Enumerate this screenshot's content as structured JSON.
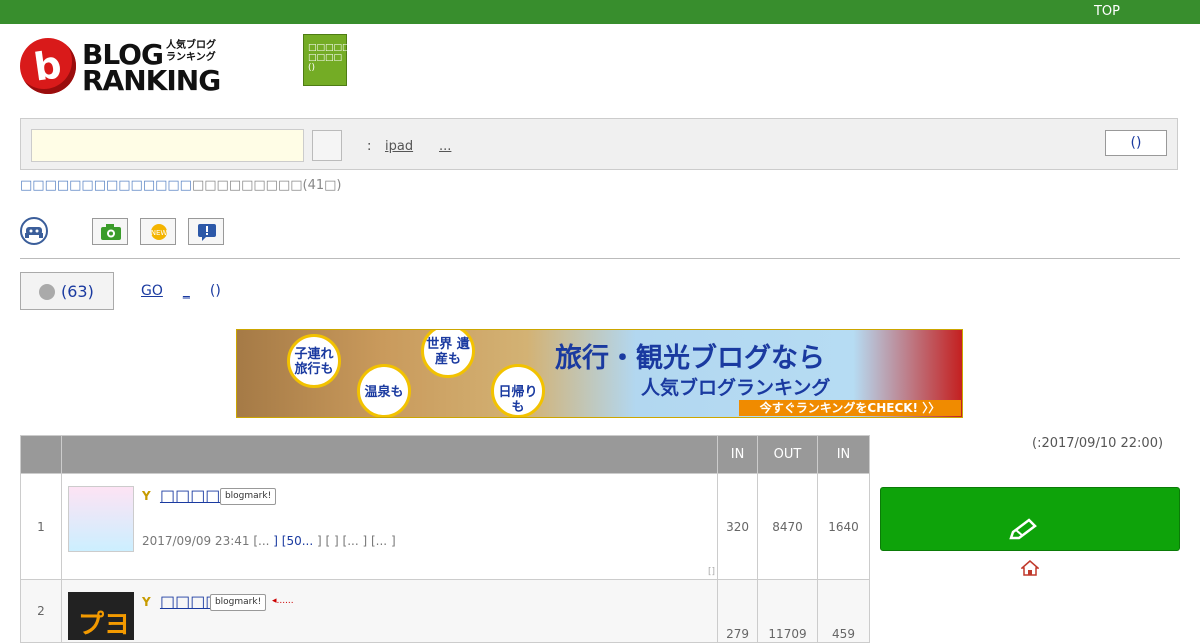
{
  "header": {
    "top_link": "TOP"
  },
  "logo": {
    "letter": "b",
    "word1": "BLOG",
    "word2": "RANKING",
    "sub": "人気ブログ ランキング"
  },
  "green_button": {
    "label1": "□□□□□ □□□□",
    "label2": "()"
  },
  "search": {
    "input_value": "",
    "colon": ":",
    "keyword1": "ipad",
    "keyword2": "...",
    "right_button": "()"
  },
  "breadcrumb": {
    "links": "□□□□□□□□□□□□□□",
    "current": "□□□□□□□□□",
    "count": "(41□)"
  },
  "vote": {
    "count": "(63)"
  },
  "links": {
    "go": "GO",
    "underscore": "_",
    "paren": "()"
  },
  "banner": {
    "bubble1": "子連れ 旅行も",
    "bubble2": "温泉も",
    "bubble3": "世界 遺産も",
    "bubble4": "日帰りも",
    "title": "旅行・観光ブログなら",
    "subtitle": "人気ブログランキング",
    "cta": "今すぐランキングをCHECK! 〉〉"
  },
  "updated": "(:2017/09/10 22:00)",
  "table": {
    "headers": [
      "",
      "",
      "IN",
      "OUT",
      "IN"
    ],
    "rows": [
      {
        "rank": "1",
        "title": "□□□□□□",
        "badge": "blogmark!",
        "meta_date": "2017/09/09 23:41",
        "meta1": "[...",
        "meta2": "] [50...",
        "meta3": "] [",
        "meta4": "] [...",
        "meta5": "] [...",
        "meta6": "]",
        "corner": "[]",
        "in": "320",
        "out": "8470",
        "in2": "1640"
      },
      {
        "rank": "2",
        "title": "□□□□□",
        "badge": "blogmark!",
        "arrow": "◂......",
        "thumb_text": "プヨ",
        "in": "279",
        "out": "11709",
        "in2": "459"
      }
    ]
  },
  "colors": {
    "topbar": "#388e2d",
    "link": "#1a3aa0",
    "big_button": "#0ea30a"
  }
}
